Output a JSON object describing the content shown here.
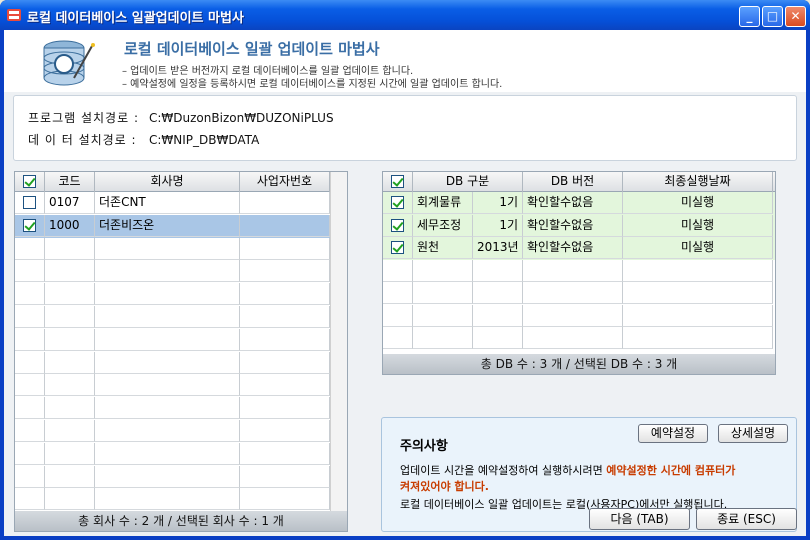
{
  "window": {
    "title": "로컬 데이터베이스 일괄업데이트 마법사",
    "colors": {
      "titlebar": "#0a5ee6",
      "accent_title": "#3a6ea5",
      "warning_text": "#c83c00",
      "selected_row": "#a9c6e6",
      "db_row": "#e3f6dc"
    }
  },
  "header": {
    "title": "로컬 데이터베이스 일괄 업데이트 마법사",
    "line1": "– 업데이트 받은 버전까지 로컬 데이터베이스를 일괄 업데이트 합니다.",
    "line2": "– 예약설정에 일정을 등록하시면 로컬 데이터베이스를 지정된 시간에 일괄 업데이트 합니다."
  },
  "paths": {
    "program_label": "프로그램 설치경로 :",
    "program_value": "C:₩DuzonBizon₩DUZONiPLUS",
    "data_label": "데 이 터 설치경로 :",
    "data_value": "C:₩NIP_DB₩DATA"
  },
  "company_grid": {
    "columns": [
      "코드",
      "회사명",
      "사업자번호"
    ],
    "rows": [
      {
        "checked": false,
        "code": "0107",
        "name": "더존CNT",
        "bizno": "",
        "selected": false
      },
      {
        "checked": true,
        "code": "1000",
        "name": "더존비즈온",
        "bizno": "",
        "selected": true
      }
    ],
    "footer": "총 회사 수 : 2 개 / 선택된 회사 수 : 1 개"
  },
  "db_grid": {
    "columns": [
      "DB 구분",
      "DB 버전",
      "최종실행날짜"
    ],
    "rows": [
      {
        "checked": true,
        "db": "회계물류",
        "period": "1기",
        "version": "확인할수없음",
        "last_run": "미실행"
      },
      {
        "checked": true,
        "db": "세무조정",
        "period": "1기",
        "version": "확인할수없음",
        "last_run": "미실행"
      },
      {
        "checked": true,
        "db": "원천",
        "period": "2013년",
        "version": "확인할수없음",
        "last_run": "미실행"
      }
    ],
    "footer": "총 DB 수 : 3 개 / 선택된 DB 수 : 3 개"
  },
  "notice": {
    "title": "주의사항",
    "schedule_button": "예약설정",
    "detail_button": "상세설명",
    "text1_plain": "업데이트 시간을 예약설정하여 실행하시려면 ",
    "text1_warn_a": "예약설정한 시간에 컴퓨터가",
    "text1_warn_b": "켜져있어야 합니다.",
    "text2": "로컬 데이터베이스 일괄 업데이트는 로컬(사용자PC)에서만 실행됩니다."
  },
  "buttons": {
    "next": "다음 (TAB)",
    "close": "종료 (ESC)"
  },
  "icons": [
    "app-icon",
    "minimize-icon",
    "maximize-icon",
    "close-icon",
    "database-wizard-icon",
    "checkbox-icon"
  ]
}
